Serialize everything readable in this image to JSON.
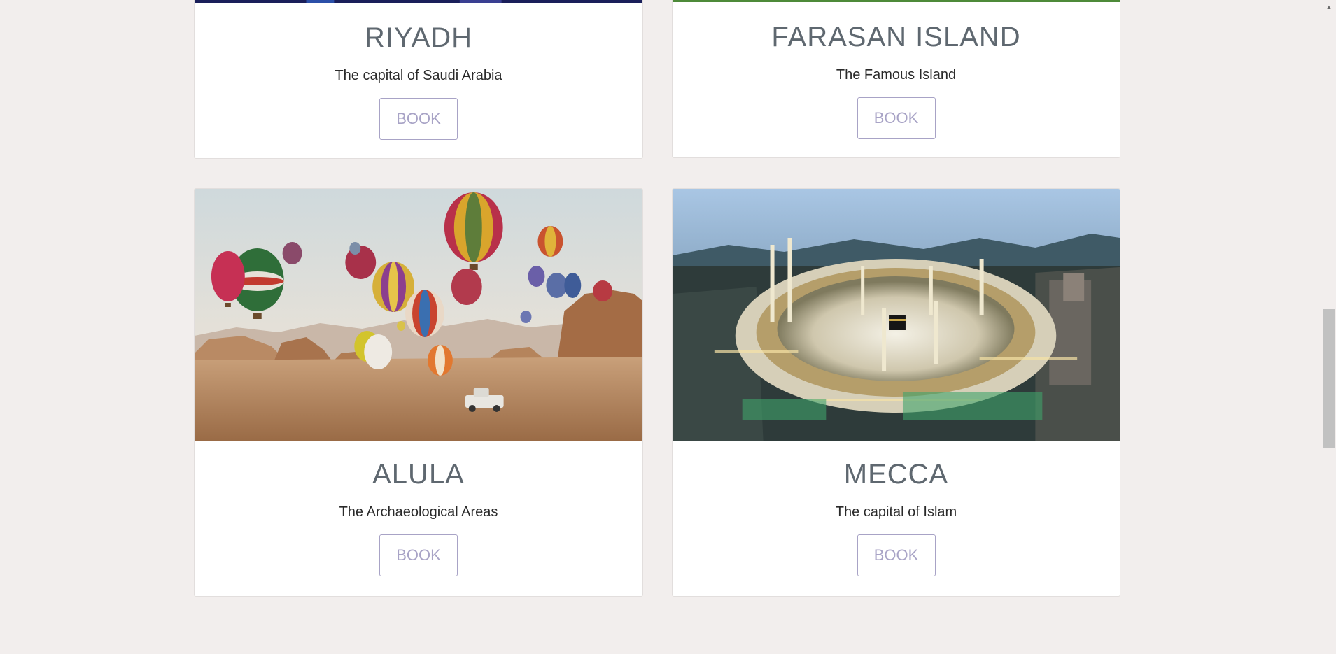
{
  "cards": [
    {
      "title": "RIYADH",
      "subtitle": "The capital of Saudi Arabia",
      "button_label": "BOOK"
    },
    {
      "title": "FARASAN ISLAND",
      "subtitle": "The Famous Island",
      "button_label": "BOOK"
    },
    {
      "title": "ALULA",
      "subtitle": "The Archaeological Areas",
      "button_label": "BOOK",
      "image_icon": "hot-air-balloons-desert-image"
    },
    {
      "title": "MECCA",
      "subtitle": "The capital of Islam",
      "button_label": "BOOK",
      "image_icon": "grand-mosque-aerial-image"
    }
  ],
  "colors": {
    "page_background": "#f2eeed",
    "card_background": "#ffffff",
    "title_color": "#5f6870",
    "button_color": "#a8a3c6"
  }
}
